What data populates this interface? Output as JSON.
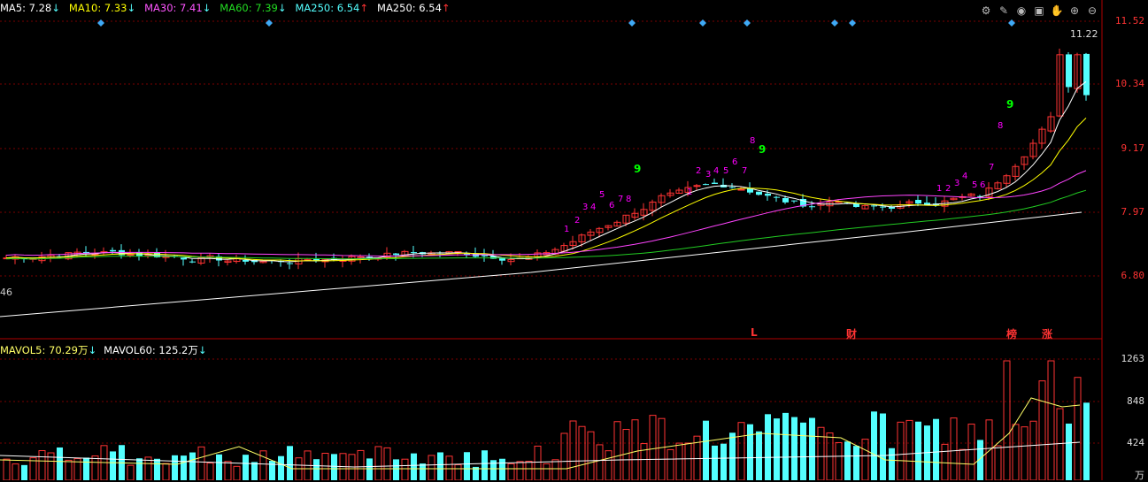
{
  "ma_legend": {
    "ma5": "MA5: 7.28",
    "ma5_arrow": "↓",
    "ma10": "MA10: 7.33",
    "ma10_arrow": "↓",
    "ma30": "MA30: 7.41",
    "ma30_arrow": "↓",
    "ma60": "MA60: 7.39",
    "ma60_arrow": "↓",
    "ma250a": "MA250: 6.54",
    "ma250a_arrow": "↑",
    "ma250b": "MA250: 6.54",
    "ma250b_arrow": "↑"
  },
  "vol_legend": {
    "mavol5": "MAVOL5: 70.29万",
    "mavol5_arrow": "↓",
    "mavol60": "MAVOL60: 125.2万",
    "mavol60_arrow": "↓"
  },
  "price_axis": [
    "11.52",
    "10.34",
    "9.17",
    "7.97",
    "6.80"
  ],
  "vol_axis": [
    "1263",
    "848",
    "424"
  ],
  "vol_unit": "万",
  "high_label": "11.22",
  "left_label": "46",
  "event_markers": [
    "L",
    "财",
    "榜",
    "涨"
  ],
  "colors": {
    "ma5": "#ffffff",
    "ma10": "#ffff00",
    "ma30": "#ff00ff",
    "ma60": "#00cc00",
    "ma250": "#ffffff",
    "up": "#ff3333",
    "down": "#54ffff",
    "grid": "#7a0000",
    "axis_red": "#ff3333",
    "magenta_num": "#ff00ff",
    "green_num": "#00ff00"
  },
  "toolbar_icons": [
    "settings-icon",
    "pencil-icon",
    "eye-icon",
    "briefcase-icon",
    "hand-icon",
    "zoom-in-icon",
    "zoom-out-icon"
  ]
}
